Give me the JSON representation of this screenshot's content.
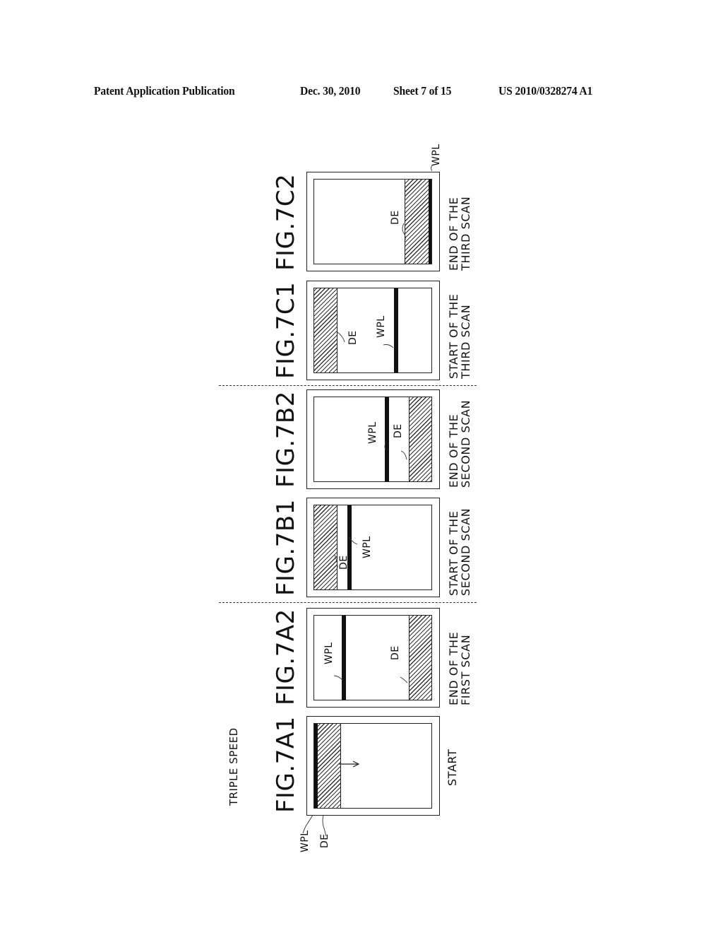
{
  "header": {
    "publication": "Patent Application Publication",
    "date": "Dec. 30, 2010",
    "sheet": "Sheet 7 of 15",
    "number": "US 2010/0328274 A1"
  },
  "title": "TRIPLE SPEED",
  "labels": {
    "wpl": "WPL",
    "de": "DE"
  },
  "figures": [
    {
      "id": "FIG.7A1",
      "caption": [
        "START"
      ]
    },
    {
      "id": "FIG.7A2",
      "caption": [
        "END OF THE",
        "FIRST SCAN"
      ]
    },
    {
      "id": "FIG.7B1",
      "caption": [
        "START OF THE",
        "SECOND SCAN"
      ]
    },
    {
      "id": "FIG.7B2",
      "caption": [
        "END OF THE",
        "SECOND SCAN"
      ]
    },
    {
      "id": "FIG.7C1",
      "caption": [
        "START OF THE",
        "THIRD SCAN"
      ]
    },
    {
      "id": "FIG.7C2",
      "caption": [
        "END OF THE",
        "THIRD SCAN"
      ]
    }
  ]
}
